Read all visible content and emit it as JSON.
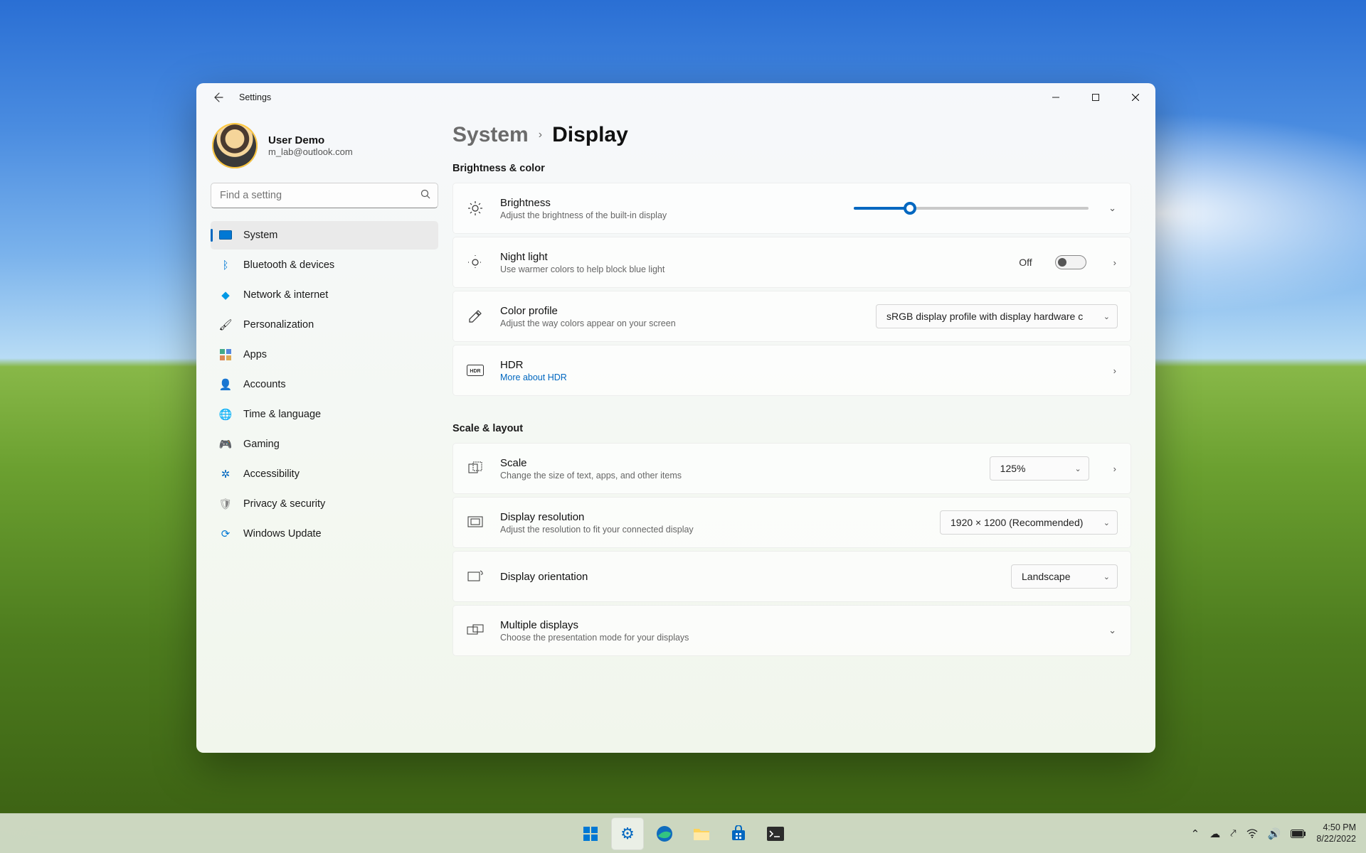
{
  "wallpaper": "bliss",
  "window": {
    "app_title": "Settings",
    "profile": {
      "name": "User Demo",
      "email": "m_lab@outlook.com"
    },
    "search": {
      "placeholder": "Find a setting"
    },
    "nav": [
      {
        "key": "system",
        "label": "System",
        "active": true
      },
      {
        "key": "bluetooth",
        "label": "Bluetooth & devices"
      },
      {
        "key": "network",
        "label": "Network & internet"
      },
      {
        "key": "personalization",
        "label": "Personalization"
      },
      {
        "key": "apps",
        "label": "Apps"
      },
      {
        "key": "accounts",
        "label": "Accounts"
      },
      {
        "key": "time",
        "label": "Time & language"
      },
      {
        "key": "gaming",
        "label": "Gaming"
      },
      {
        "key": "accessibility",
        "label": "Accessibility"
      },
      {
        "key": "privacy",
        "label": "Privacy & security"
      },
      {
        "key": "update",
        "label": "Windows Update"
      }
    ],
    "breadcrumb": {
      "parent": "System",
      "current": "Display"
    },
    "sections": {
      "brightness_color": {
        "label": "Brightness & color",
        "brightness": {
          "title": "Brightness",
          "subtitle": "Adjust the brightness of the built-in display",
          "value_pct": 24
        },
        "night_light": {
          "title": "Night light",
          "subtitle": "Use warmer colors to help block blue light",
          "state": "Off",
          "on": false
        },
        "color_profile": {
          "title": "Color profile",
          "subtitle": "Adjust the way colors appear on your screen",
          "selected": "sRGB display profile with display hardware c"
        },
        "hdr": {
          "title": "HDR",
          "link": "More about HDR"
        }
      },
      "scale_layout": {
        "label": "Scale & layout",
        "scale": {
          "title": "Scale",
          "subtitle": "Change the size of text, apps, and other items",
          "selected": "125%"
        },
        "resolution": {
          "title": "Display resolution",
          "subtitle": "Adjust the resolution to fit your connected display",
          "selected": "1920 × 1200 (Recommended)"
        },
        "orientation": {
          "title": "Display orientation",
          "selected": "Landscape"
        },
        "multiple": {
          "title": "Multiple displays",
          "subtitle": "Choose the presentation mode for your displays"
        }
      }
    }
  },
  "taskbar": {
    "apps": [
      {
        "key": "start",
        "label": "Start"
      },
      {
        "key": "settings",
        "label": "Settings",
        "active": true
      },
      {
        "key": "edge",
        "label": "Edge"
      },
      {
        "key": "explorer",
        "label": "File Explorer"
      },
      {
        "key": "store",
        "label": "Microsoft Store"
      },
      {
        "key": "terminal",
        "label": "Terminal"
      }
    ],
    "tray": {
      "time": "4:50 PM",
      "date": "8/22/2022"
    }
  }
}
